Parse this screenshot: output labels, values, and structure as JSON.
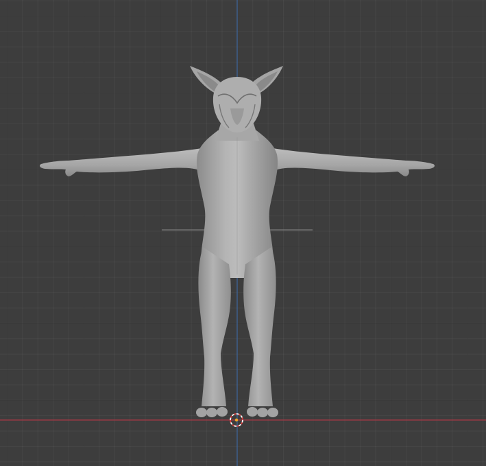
{
  "viewport": {
    "background_color": "#3d3d3d",
    "grid_minor_color": "#464646",
    "grid_major_color": "#333333"
  },
  "axes": {
    "x_axis_color": "#a83a46",
    "z_axis_color": "#3f68a0"
  },
  "model": {
    "icon": "creature-mesh-icon",
    "surface_color": "#a9a9a9",
    "shade_color": "#7a7a7a",
    "highlight_color": "#c4c4c4"
  },
  "cursor_3d": {
    "icon": "3d-cursor-icon",
    "ring_color_a": "#e23c3c",
    "ring_color_b": "#ffffff",
    "center_color": "#f5a623"
  }
}
